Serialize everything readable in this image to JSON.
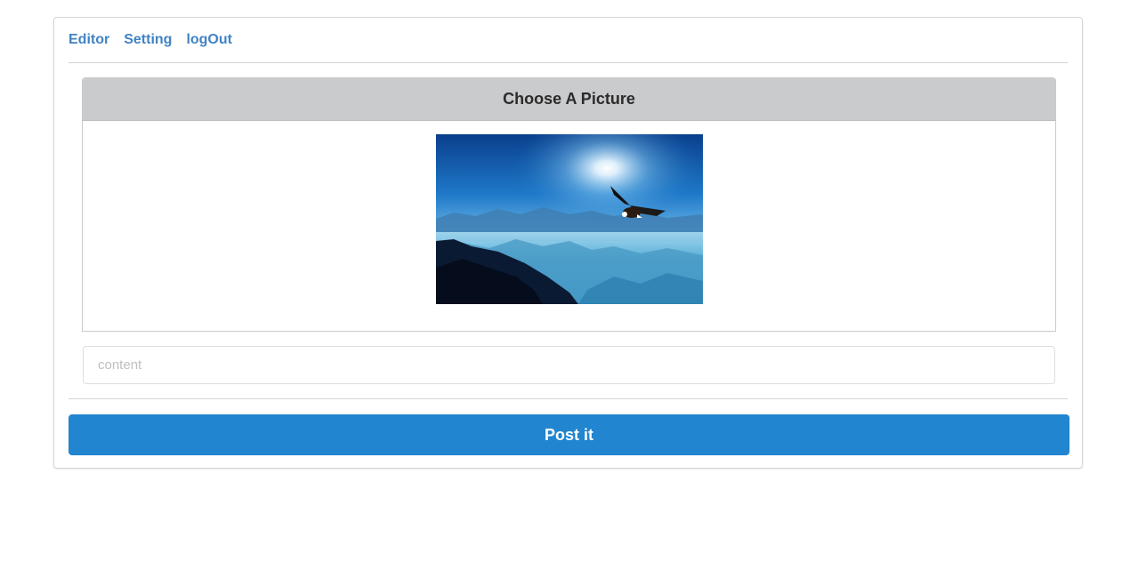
{
  "nav": {
    "items": [
      {
        "label": "Editor"
      },
      {
        "label": "Setting"
      },
      {
        "label": "logOut"
      }
    ],
    "link_color": "#4183c4"
  },
  "picture_panel": {
    "header_label": "Choose A Picture",
    "image_subject": "eagle flying over misty blue mountains with sun"
  },
  "content_field": {
    "value": "",
    "placeholder": "content"
  },
  "post_button": {
    "label": "Post it",
    "color": "#2185d0"
  }
}
